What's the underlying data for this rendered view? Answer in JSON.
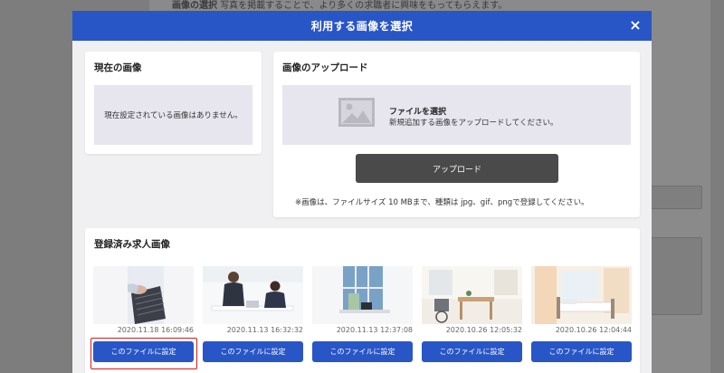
{
  "background": {
    "note_bold": "画像の選択",
    "note_text": "写真を掲載することで、より多くの求職者に興味をもってもらえます。"
  },
  "modal": {
    "title": "利用する画像を選択",
    "close_label": "×"
  },
  "current_image": {
    "title": "現在の画像",
    "empty_text": "現在設定されている画像はありません。"
  },
  "upload": {
    "title": "画像のアップロード",
    "select_label": "ファイルを選択",
    "select_hint": "新規追加する画像をアップロードしてください。",
    "button_label": "アップロード",
    "note": "※画像は、ファイルサイズ 10 MBまで、種類は jpg、gif、pngで登録してください。"
  },
  "registered": {
    "title": "登録済み求人画像",
    "set_label": "このファイルに設定",
    "items": [
      {
        "timestamp": "2020.11.18 16:09:46",
        "subject": "keyboard-hands-photo"
      },
      {
        "timestamp": "2020.11.13 16:32:32",
        "subject": "office-meeting-photo"
      },
      {
        "timestamp": "2020.11.13 12:37:08",
        "subject": "office-desk-window-photo"
      },
      {
        "timestamp": "2020.10.26 12:05:32",
        "subject": "clinic-room-photo"
      },
      {
        "timestamp": "2020.10.26 12:04:44",
        "subject": "hospital-room-photo"
      }
    ]
  },
  "colors": {
    "header_blue": "#2956c6",
    "set_button_blue": "#2956c6",
    "upload_button_dark": "#4a4a4a",
    "highlight_red": "#d21e1e"
  }
}
